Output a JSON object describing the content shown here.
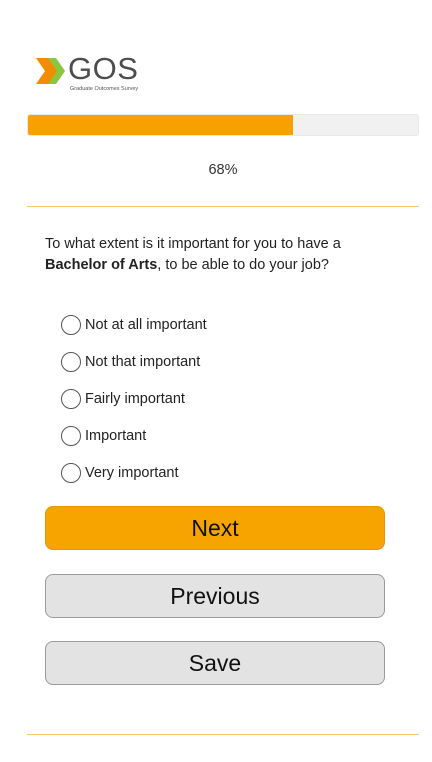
{
  "brand": {
    "logo_text": "GOS",
    "logo_subtitle": "Graduate Outcomes Survey",
    "logo_colors": {
      "left": "#f28c00",
      "right": "#8cc63f"
    },
    "text_color": "#4d4d4d"
  },
  "progress": {
    "percent": 68,
    "label": "68%",
    "fill_color": "#f7a000",
    "track_color": "#f1f1f1"
  },
  "question": {
    "prefix": "To what extent is it important for you to have a ",
    "emphasis": "Bachelor of Arts",
    "suffix": ", to be able to do your job?"
  },
  "options": [
    {
      "label": "Not at all important",
      "selected": false
    },
    {
      "label": "Not that important",
      "selected": false
    },
    {
      "label": "Fairly important",
      "selected": false
    },
    {
      "label": "Important",
      "selected": false
    },
    {
      "label": "Very important",
      "selected": false
    }
  ],
  "buttons": {
    "next": "Next",
    "previous": "Previous",
    "save": "Save",
    "next_color": "#f7a300",
    "secondary_color": "#e3e3e3"
  },
  "accent_line_color": "#f4c56a"
}
